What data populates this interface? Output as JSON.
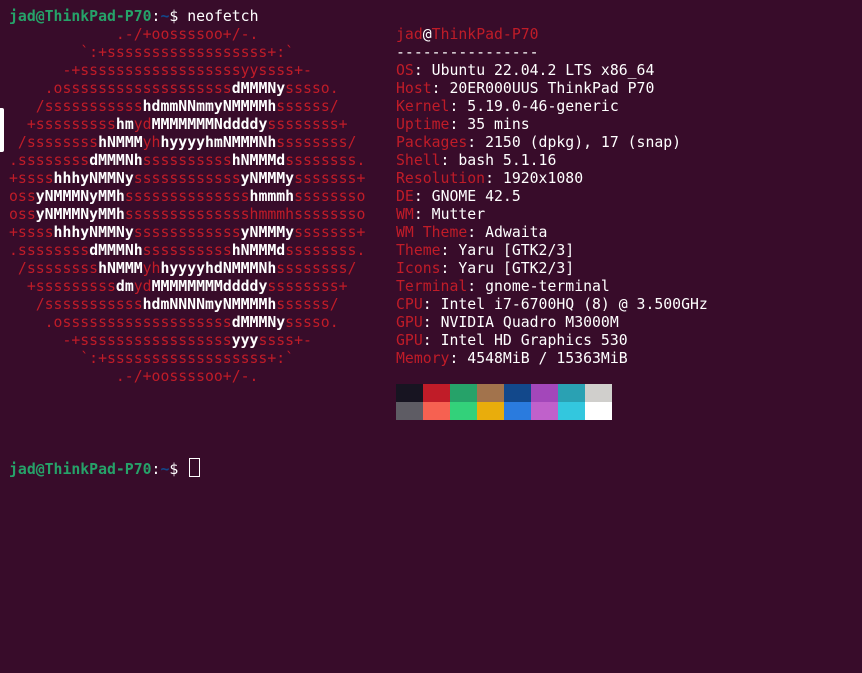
{
  "prompt": {
    "user": "jad@ThinkPad-P70",
    "sep": ":",
    "path": "~",
    "symbol": "$",
    "command": "neofetch"
  },
  "logo": [
    [
      [
        "r",
        "            .-/+oossssoo+/-."
      ]
    ],
    [
      [
        "r",
        "        `:+ssssssssssssssssss+:`"
      ]
    ],
    [
      [
        "r",
        "      -+ssssssssssssssssssyyssss+-"
      ]
    ],
    [
      [
        "r",
        "    .osssssssssssssssssss"
      ],
      [
        "w",
        "dMMMNy"
      ],
      [
        "r",
        "sssso."
      ]
    ],
    [
      [
        "r",
        "   /sssssssssss"
      ],
      [
        "w",
        "hdmmNNmmyNMMMMh"
      ],
      [
        "r",
        "ssssss/"
      ]
    ],
    [
      [
        "r",
        "  +sssssssss"
      ],
      [
        "w",
        "hm"
      ],
      [
        "r",
        "yd"
      ],
      [
        "w",
        "MMMMMMMNddddy"
      ],
      [
        "r",
        "ssssssss+"
      ]
    ],
    [
      [
        "r",
        " /ssssssss"
      ],
      [
        "w",
        "hNMMM"
      ],
      [
        "r",
        "yh"
      ],
      [
        "w",
        "hyyyyhmNMMMNh"
      ],
      [
        "r",
        "ssssssss/"
      ]
    ],
    [
      [
        "r",
        ".ssssssss"
      ],
      [
        "w",
        "dMMMNh"
      ],
      [
        "r",
        "ssssssssss"
      ],
      [
        "w",
        "hNMMMd"
      ],
      [
        "r",
        "ssssssss."
      ]
    ],
    [
      [
        "r",
        "+ssss"
      ],
      [
        "w",
        "hhhyNMMNy"
      ],
      [
        "r",
        "ssssssssssss"
      ],
      [
        "w",
        "yNMMMy"
      ],
      [
        "r",
        "sssssss+"
      ]
    ],
    [
      [
        "r",
        "oss"
      ],
      [
        "w",
        "yNMMMNyMMh"
      ],
      [
        "r",
        "ssssssssssssss"
      ],
      [
        "w",
        "hmmmh"
      ],
      [
        "r",
        "ssssssso"
      ]
    ],
    [
      [
        "r",
        "oss"
      ],
      [
        "w",
        "yNMMMNyMMh"
      ],
      [
        "r",
        "sssssssssssssshmmmhssssssso"
      ]
    ],
    [
      [
        "r",
        "+ssss"
      ],
      [
        "w",
        "hhhyNMMNy"
      ],
      [
        "r",
        "ssssssssssss"
      ],
      [
        "w",
        "yNMMMy"
      ],
      [
        "r",
        "sssssss+"
      ]
    ],
    [
      [
        "r",
        ".ssssssss"
      ],
      [
        "w",
        "dMMMNh"
      ],
      [
        "r",
        "ssssssssss"
      ],
      [
        "w",
        "hNMMMd"
      ],
      [
        "r",
        "ssssssss."
      ]
    ],
    [
      [
        "r",
        " /ssssssss"
      ],
      [
        "w",
        "hNMMM"
      ],
      [
        "r",
        "yh"
      ],
      [
        "w",
        "hyyyyhdNMMMNh"
      ],
      [
        "r",
        "ssssssss/"
      ]
    ],
    [
      [
        "r",
        "  +sssssssss"
      ],
      [
        "w",
        "dm"
      ],
      [
        "r",
        "yd"
      ],
      [
        "w",
        "MMMMMMMMddddy"
      ],
      [
        "r",
        "ssssssss+"
      ]
    ],
    [
      [
        "r",
        "   /sssssssssss"
      ],
      [
        "w",
        "hdmNNNNmyNMMMMh"
      ],
      [
        "r",
        "ssssss/"
      ]
    ],
    [
      [
        "r",
        "    .osssssssssssssssssss"
      ],
      [
        "w",
        "dMMMNy"
      ],
      [
        "r",
        "sssso."
      ]
    ],
    [
      [
        "r",
        "      -+sssssssssssssssss"
      ],
      [
        "w",
        "yyy"
      ],
      [
        "r",
        "ssss+-"
      ]
    ],
    [
      [
        "r",
        "        `:+ssssssssssssssssss+:`"
      ]
    ],
    [
      [
        "r",
        "            .-/+oossssoo+/-."
      ]
    ]
  ],
  "info": {
    "title_user": "jad",
    "title_at": "@",
    "title_host": "ThinkPad-P70",
    "divider": "----------------",
    "rows": [
      {
        "key": "OS",
        "value": "Ubuntu 22.04.2 LTS x86_64"
      },
      {
        "key": "Host",
        "value": "20ER000UUS ThinkPad P70"
      },
      {
        "key": "Kernel",
        "value": "5.19.0-46-generic"
      },
      {
        "key": "Uptime",
        "value": "35 mins"
      },
      {
        "key": "Packages",
        "value": "2150 (dpkg), 17 (snap)"
      },
      {
        "key": "Shell",
        "value": "bash 5.1.16"
      },
      {
        "key": "Resolution",
        "value": "1920x1080"
      },
      {
        "key": "DE",
        "value": "GNOME 42.5"
      },
      {
        "key": "WM",
        "value": "Mutter"
      },
      {
        "key": "WM Theme",
        "value": "Adwaita"
      },
      {
        "key": "Theme",
        "value": "Yaru [GTK2/3]"
      },
      {
        "key": "Icons",
        "value": "Yaru [GTK2/3]"
      },
      {
        "key": "Terminal",
        "value": "gnome-terminal"
      },
      {
        "key": "CPU",
        "value": "Intel i7-6700HQ (8) @ 3.500GHz"
      },
      {
        "key": "GPU",
        "value": "NVIDIA Quadro M3000M"
      },
      {
        "key": "GPU",
        "value": "Intel HD Graphics 530"
      },
      {
        "key": "Memory",
        "value": "4548MiB / 15363MiB"
      }
    ]
  },
  "palette": {
    "normal": [
      "#171421",
      "#c01c28",
      "#26a269",
      "#a2734c",
      "#12488b",
      "#a347ba",
      "#2aa1b3",
      "#d0cfcc"
    ],
    "bright": [
      "#5e5c64",
      "#f66151",
      "#33d17a",
      "#e9ad0c",
      "#2a7bde",
      "#c061cb",
      "#33c7de",
      "#ffffff"
    ]
  },
  "colors": {
    "background": "#380c2a",
    "prompt_user": "#26a269",
    "prompt_path": "#12488b",
    "accent_red": "#c01c28"
  }
}
